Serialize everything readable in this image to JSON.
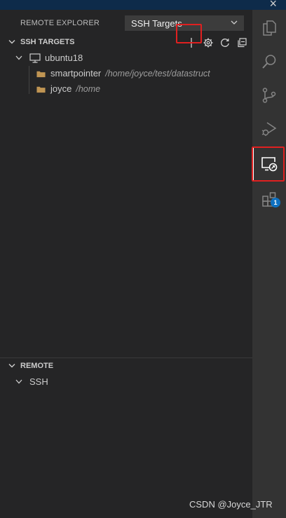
{
  "window": {
    "close_glyph": "×"
  },
  "sidebar": {
    "title": "REMOTE EXPLORER",
    "target_select": {
      "value": "SSH Targets"
    }
  },
  "ssh_section": {
    "label": "SSH TARGETS",
    "actions": [
      {
        "name": "add-new-target",
        "icon": "plus-icon"
      },
      {
        "name": "configure",
        "icon": "gear-icon"
      },
      {
        "name": "refresh",
        "icon": "refresh-icon"
      },
      {
        "name": "collapse-all",
        "icon": "collapse-all-icon"
      }
    ],
    "host": {
      "label": "ubuntu18",
      "icon": "monitor-icon"
    },
    "folders": [
      {
        "label": "smartpointer",
        "path": "/home/joyce/test/datastruct"
      },
      {
        "label": "joyce",
        "path": "/home"
      }
    ]
  },
  "remote_section": {
    "label": "REMOTE",
    "items": [
      {
        "label": "SSH"
      }
    ]
  },
  "activity_bar": {
    "items": [
      {
        "name": "explorer",
        "icon": "files-icon"
      },
      {
        "name": "search",
        "icon": "search-icon"
      },
      {
        "name": "source-control",
        "icon": "source-control-icon"
      },
      {
        "name": "run-debug",
        "icon": "run-debug-icon"
      },
      {
        "name": "remote-explorer",
        "icon": "remote-explorer-icon",
        "active": true
      },
      {
        "name": "extensions",
        "icon": "extensions-icon",
        "badge": "1"
      }
    ]
  },
  "colors": {
    "highlight": "#e02020",
    "folder": "#c09553",
    "badge": "#0e70c0"
  },
  "watermark": "CSDN @Joyce_JTR"
}
